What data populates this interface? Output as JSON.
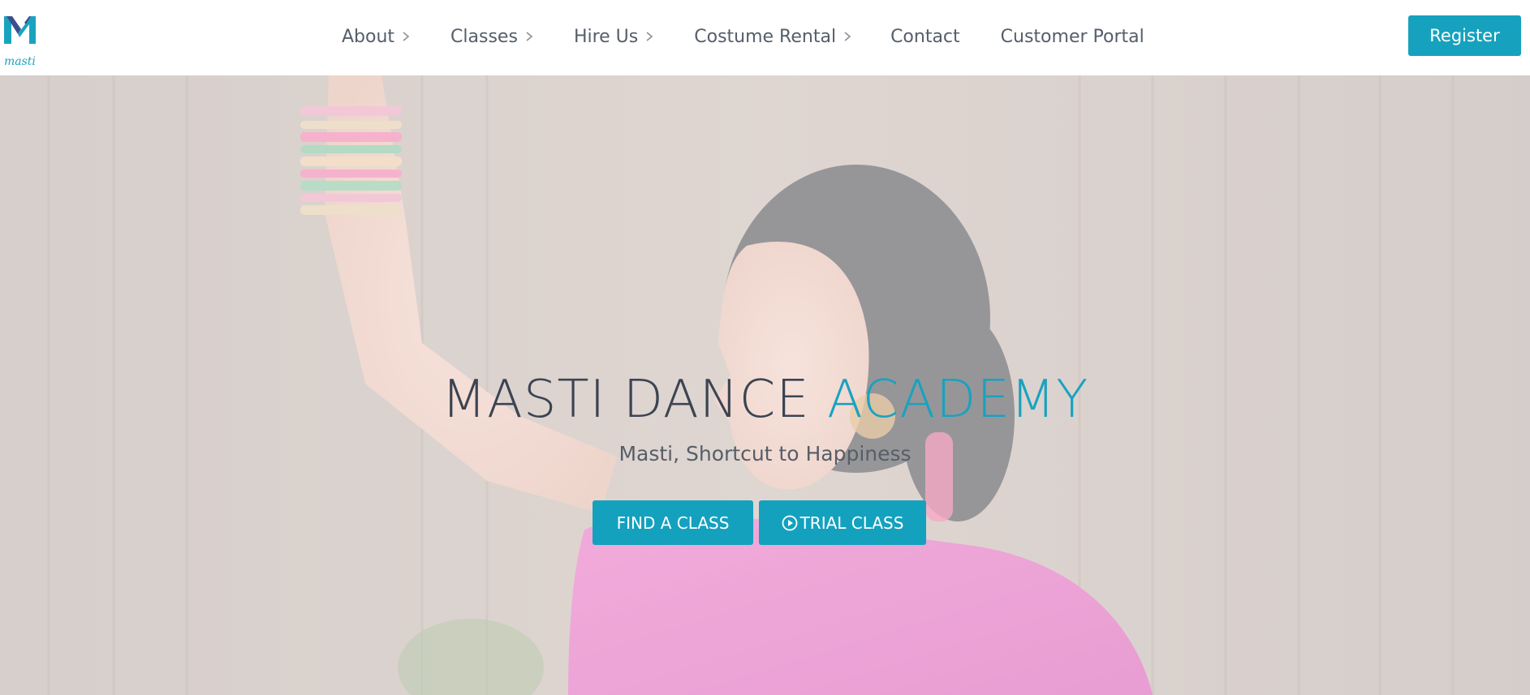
{
  "brand": {
    "logo_text": "masti",
    "logo_icon": "masti-m-logo-icon",
    "accent_color": "#16a2be"
  },
  "nav": {
    "items": [
      {
        "label": "About",
        "has_submenu": true
      },
      {
        "label": "Classes",
        "has_submenu": true
      },
      {
        "label": "Hire Us",
        "has_submenu": true
      },
      {
        "label": "Costume Rental",
        "has_submenu": true
      },
      {
        "label": "Contact",
        "has_submenu": false
      },
      {
        "label": "Customer Portal",
        "has_submenu": false
      }
    ],
    "register_label": "Register"
  },
  "hero": {
    "title_main": "MASTI DANCE ",
    "title_accent": "ACADEMY",
    "subtitle": "Masti, Shortcut to Happiness",
    "find_class_label": "FIND A CLASS",
    "trial_class_label": "TRIAL CLASS",
    "trial_icon": "play-circle-icon"
  },
  "colors": {
    "button": "#14a1be",
    "title_dark": "#3b4452",
    "nav_text": "#555e6b"
  }
}
